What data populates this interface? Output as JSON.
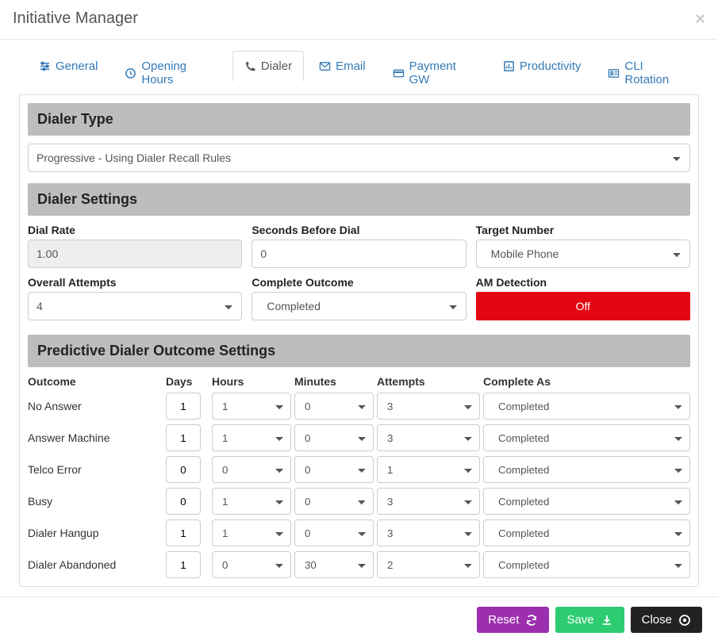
{
  "modal": {
    "title": "Initiative Manager"
  },
  "tabs": {
    "general": "General",
    "opening": "Opening Hours",
    "dialer": "Dialer",
    "email": "Email",
    "payment": "Payment GW",
    "productivity": "Productivity",
    "cli": "CLI Rotation"
  },
  "sections": {
    "dialer_type": "Dialer Type",
    "dialer_settings": "Dialer Settings",
    "predictive": "Predictive Dialer Outcome Settings"
  },
  "dialer_type_value": "Progressive - Using Dialer Recall Rules",
  "settings": {
    "dial_rate_label": "Dial Rate",
    "dial_rate_value": "1.00",
    "seconds_label": "Seconds Before Dial",
    "seconds_value": "0",
    "target_label": "Target Number",
    "target_value": "Mobile Phone",
    "overall_label": "Overall Attempts",
    "overall_value": "4",
    "complete_outcome_label": "Complete Outcome",
    "complete_outcome_value": "Completed",
    "am_label": "AM Detection",
    "am_value": "Off"
  },
  "outcome_headers": {
    "outcome": "Outcome",
    "days": "Days",
    "hours": "Hours",
    "minutes": "Minutes",
    "attempts": "Attempts",
    "complete_as": "Complete As"
  },
  "outcomes": [
    {
      "name": "No Answer",
      "days": "1",
      "hours": "1",
      "minutes": "0",
      "attempts": "3",
      "complete_as": "Completed"
    },
    {
      "name": "Answer Machine",
      "days": "1",
      "hours": "1",
      "minutes": "0",
      "attempts": "3",
      "complete_as": "Completed"
    },
    {
      "name": "Telco Error",
      "days": "0",
      "hours": "0",
      "minutes": "0",
      "attempts": "1",
      "complete_as": "Completed"
    },
    {
      "name": "Busy",
      "days": "0",
      "hours": "1",
      "minutes": "0",
      "attempts": "3",
      "complete_as": "Completed"
    },
    {
      "name": "Dialer Hangup",
      "days": "1",
      "hours": "1",
      "minutes": "0",
      "attempts": "3",
      "complete_as": "Completed"
    },
    {
      "name": "Dialer Abandoned",
      "days": "1",
      "hours": "0",
      "minutes": "30",
      "attempts": "2",
      "complete_as": "Completed"
    }
  ],
  "footer": {
    "reset": "Reset",
    "save": "Save",
    "close": "Close"
  }
}
